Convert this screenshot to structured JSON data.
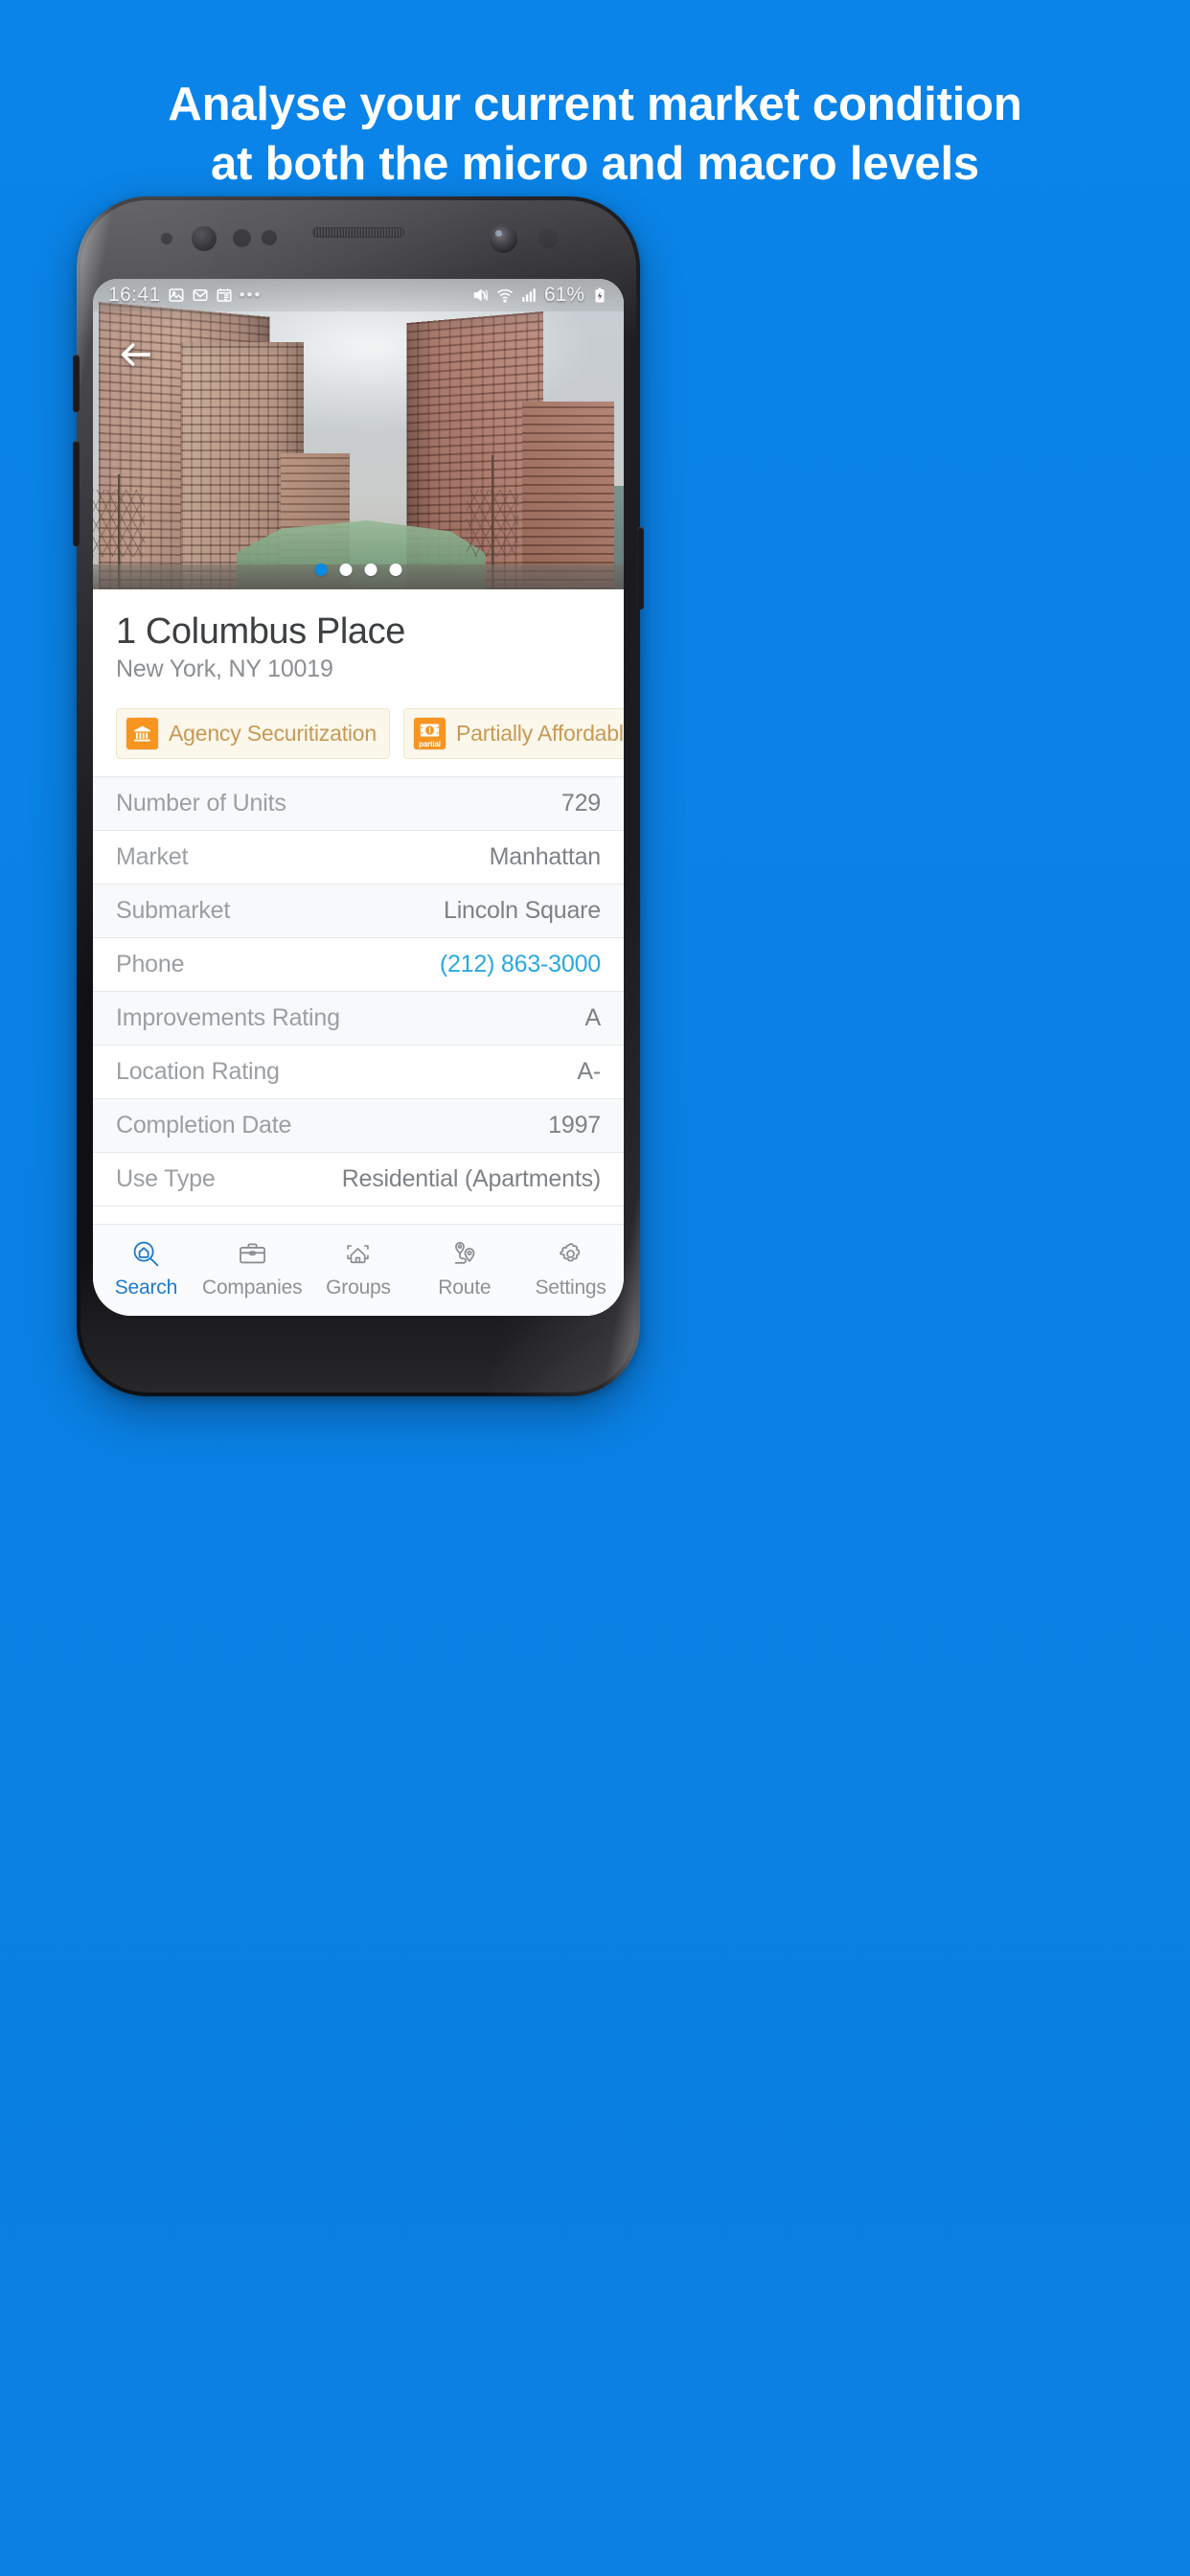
{
  "promo": {
    "headline_line1": "Analyse your current market condition",
    "headline_line2": "at both the micro and macro levels",
    "background_color": "#0a84e8"
  },
  "status_bar": {
    "time": "16:41",
    "icons_left": [
      "image-icon",
      "mail-icon",
      "calendar-icon",
      "more-dots-icon"
    ],
    "overflow_dots": "•••",
    "icons_right": [
      "mute-vibrate-icon",
      "wifi-icon",
      "signal-icon"
    ],
    "battery_percent": "61%",
    "battery_state": "charging"
  },
  "hero": {
    "back_icon": "back-arrow-icon",
    "carousel": {
      "total": 4,
      "active_index": 0
    }
  },
  "property": {
    "title": "1 Columbus Place",
    "address": "New York, NY 10019",
    "badges": [
      {
        "label": "Agency Securitization",
        "icon": "bank-icon",
        "icon_color": "#f79520",
        "text_color": "#c79a56"
      },
      {
        "label": "Partially Affordable",
        "icon": "banknote-icon",
        "icon_tag": "partial",
        "icon_color": "#f79520",
        "text_color": "#c79a56"
      }
    ],
    "details": [
      {
        "label": "Number of Units",
        "value": "729",
        "link": false
      },
      {
        "label": "Market",
        "value": "Manhattan",
        "link": false
      },
      {
        "label": "Submarket",
        "value": "Lincoln Square",
        "link": false
      },
      {
        "label": "Phone",
        "value": "(212) 863-3000",
        "link": true
      },
      {
        "label": "Improvements Rating",
        "value": "A",
        "link": false
      },
      {
        "label": "Location Rating",
        "value": "A-",
        "link": false
      },
      {
        "label": "Completion Date",
        "value": "1997",
        "link": false
      },
      {
        "label": "Use Type",
        "value": "Residential (Apartments)",
        "link": false
      }
    ]
  },
  "tabbar": {
    "active_index": 0,
    "active_color": "#1878c8",
    "inactive_color": "#8b8f93",
    "items": [
      {
        "label": "Search",
        "icon": "search-home-icon"
      },
      {
        "label": "Companies",
        "icon": "briefcase-icon"
      },
      {
        "label": "Groups",
        "icon": "home-brackets-icon"
      },
      {
        "label": "Route",
        "icon": "route-pins-icon"
      },
      {
        "label": "Settings",
        "icon": "gear-icon"
      }
    ]
  }
}
